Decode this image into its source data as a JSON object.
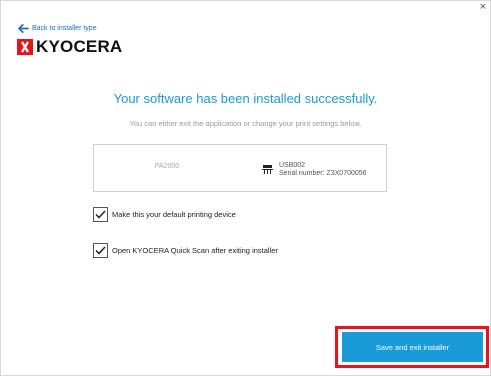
{
  "window": {
    "close_glyph": "×"
  },
  "nav": {
    "back_label": "Back to installer type",
    "back_icon": "arrow-left-icon"
  },
  "brand": {
    "name": "KYOCERA",
    "logo_icon": "kyocera-logo-icon",
    "color": "#e8141c"
  },
  "main": {
    "heading": "Your software has been installed successfully.",
    "subheading": "You can either exit the application or change your print settings below."
  },
  "device": {
    "model": "PA2000",
    "port": "USB002",
    "serial": "Serial number: Z3X0700056",
    "port_icon": "usb-port-icon"
  },
  "options": [
    {
      "label": "Make this your default printing device",
      "checked": true
    },
    {
      "label": "Open KYOCERA Quick Scan after exiting installer",
      "checked": true
    }
  ],
  "actions": {
    "primary_label": "Save and exit installer"
  },
  "colors": {
    "accent": "#1a9bd7",
    "link": "#1a6fb8",
    "highlight": "#e8141c"
  }
}
